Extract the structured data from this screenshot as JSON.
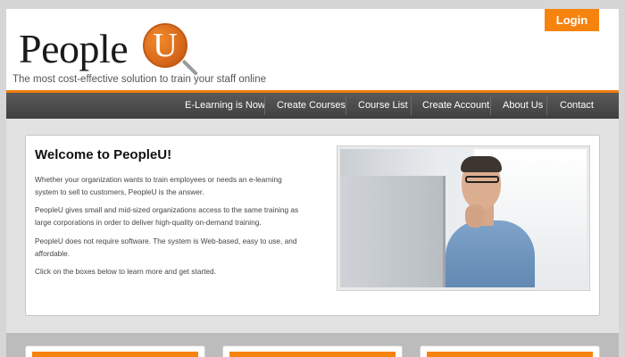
{
  "header": {
    "logo_text": "People",
    "logo_letter": "U",
    "tagline": "The most cost-effective solution to train your staff online",
    "login_label": "Login"
  },
  "nav": {
    "items": [
      "E-Learning is Now",
      "Create Courses",
      "Course List",
      "Create Account",
      "About Us",
      "Contact"
    ]
  },
  "welcome": {
    "title": "Welcome to PeopleU!",
    "paragraphs": [
      "Whether your organization wants to train employees or needs an e-learning system to sell to customers, PeopleU is the answer.",
      "PeopleU gives small and mid-sized organizations access to the same training as large corporations in order to deliver high-quality on-demand training.",
      "PeopleU does not require software. The system is Web-based, easy to use, and affordable.",
      "Click on the boxes below to learn more and get started."
    ]
  },
  "colors": {
    "accent": "#f7830f",
    "nav_bg": "#4a4a4a",
    "page_bg": "#d6d6d6"
  }
}
